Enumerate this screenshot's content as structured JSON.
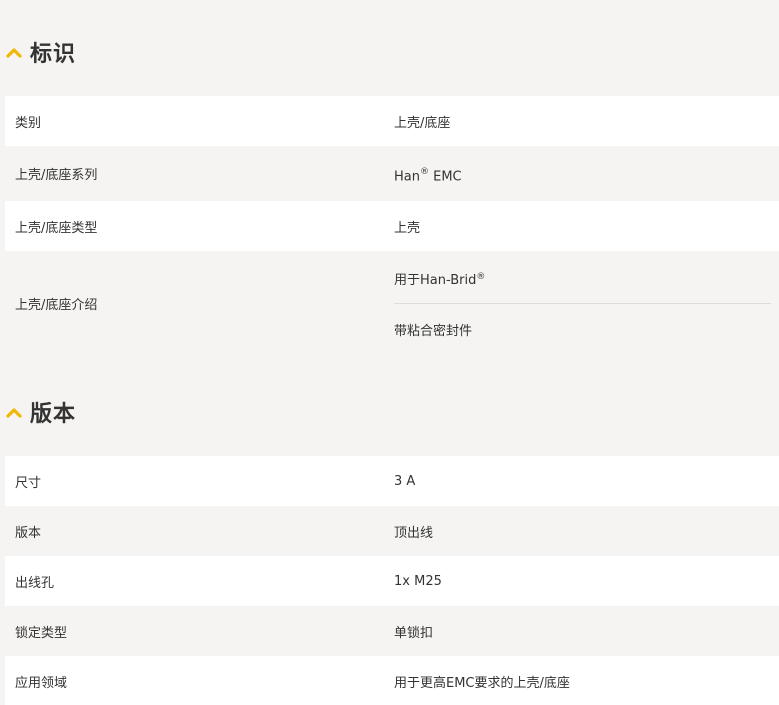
{
  "colors": {
    "accent": "#f2b705",
    "row_white": "#ffffff",
    "row_grey": "#f5f4f2"
  },
  "sections": [
    {
      "title": "标识",
      "icon": "chevron-up-icon",
      "rows": [
        {
          "label": "类别",
          "value": "上壳/底座"
        },
        {
          "label": "上壳/底座系列",
          "value": "Han",
          "value_sup": "®",
          "value_suffix": " EMC"
        },
        {
          "label": "上壳/底座类型",
          "value": "上壳"
        },
        {
          "label": "上壳/底座介绍",
          "values": [
            {
              "text": "用于Han-Brid",
              "sup": "®"
            },
            {
              "text": "带粘合密封件"
            }
          ]
        }
      ]
    },
    {
      "title": "版本",
      "icon": "chevron-up-icon",
      "rows": [
        {
          "label": "尺寸",
          "value": "3 A"
        },
        {
          "label": "版本",
          "value": "顶出线"
        },
        {
          "label": "出线孔",
          "value": "1x M25"
        },
        {
          "label": "锁定类型",
          "value": "单锁扣"
        },
        {
          "label": "应用领域",
          "value": "用于更高EMC要求的上壳/底座"
        }
      ]
    }
  ]
}
